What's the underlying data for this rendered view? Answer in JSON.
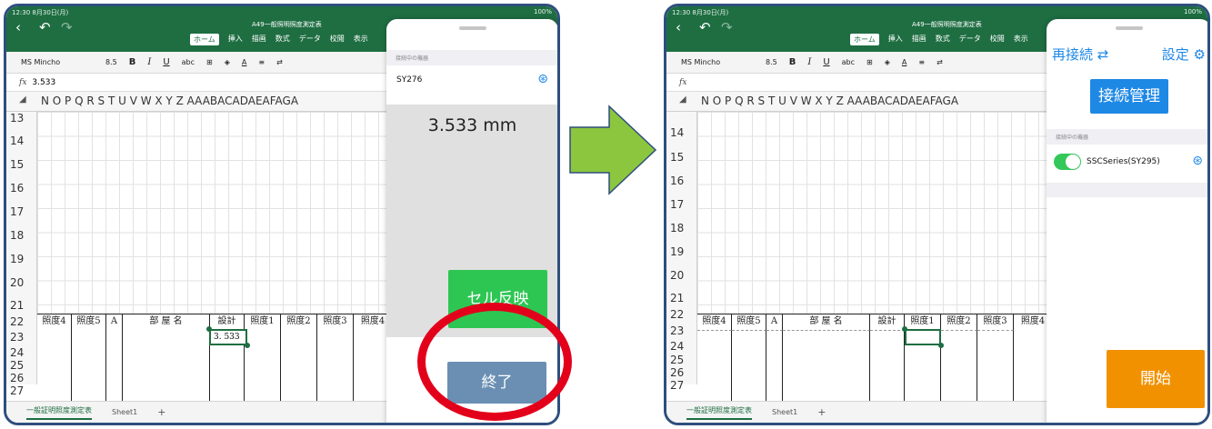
{
  "status": {
    "time": "12:30",
    "date": "8月30日(月)",
    "battery": "100%"
  },
  "document_title": "A49一般照明照度測定表",
  "ribbon_tabs": [
    "ホーム",
    "挿入",
    "描画",
    "数式",
    "データ",
    "校閲",
    "表示"
  ],
  "format_bar": {
    "font": "MS Mincho",
    "size": "8.5",
    "bold": "B",
    "italic": "I",
    "underline": "U",
    "strike": "abc",
    "wrap": "折"
  },
  "left": {
    "formula_value": "3.533",
    "column_headers": "N O P Q R S T U V W X Y Z AAABACADAEAFAGA",
    "rows": [
      "13",
      "14",
      "15",
      "16",
      "17",
      "18",
      "19",
      "20",
      "21",
      "22",
      "23",
      "24",
      "25",
      "26",
      "27"
    ],
    "table_headers": [
      "照度4",
      "照度5",
      "A",
      "部 屋 名",
      "設計",
      "照度1",
      "照度2",
      "照度3",
      "照度4"
    ],
    "selected_cell_value": "3. 533",
    "sheet_tabs": [
      "一般証明照度測定表",
      "Sheet1",
      "+"
    ],
    "panel": {
      "section_label": "接続中の機器",
      "device_name": "SY276",
      "measurement": "3.533 mm",
      "reflect_button": "セル反映",
      "end_button": "終了"
    }
  },
  "right": {
    "formula_value": "",
    "column_headers": "N O P Q R S T U V W X Y Z AAABACADAEAFAGA",
    "rows": [
      "14",
      "15",
      "16",
      "17",
      "18",
      "19",
      "20",
      "21",
      "22",
      "23",
      "24",
      "25",
      "26",
      "27"
    ],
    "table_headers": [
      "照度4",
      "照度5",
      "A",
      "部 屋 名",
      "設計",
      "照度1",
      "照度2",
      "照度3",
      "照度4"
    ],
    "sheet_tabs": [
      "一般証明照度測定表",
      "Sheet1",
      "+"
    ],
    "panel": {
      "reconnect_label": "再接続",
      "settings_label": "設定",
      "manage_button": "接続管理",
      "section_label": "接続中の機器",
      "device_name": "SSCSeries(SY295)",
      "start_button": "開始"
    }
  },
  "colors": {
    "excel_green": "#1e6e42",
    "green_button": "#2dc653",
    "blue_button": "#1e88e5",
    "steel_button": "#6a8fb3",
    "orange_button": "#f29100",
    "highlight_ring": "#e3001b",
    "arrow": "#8cc63f"
  }
}
